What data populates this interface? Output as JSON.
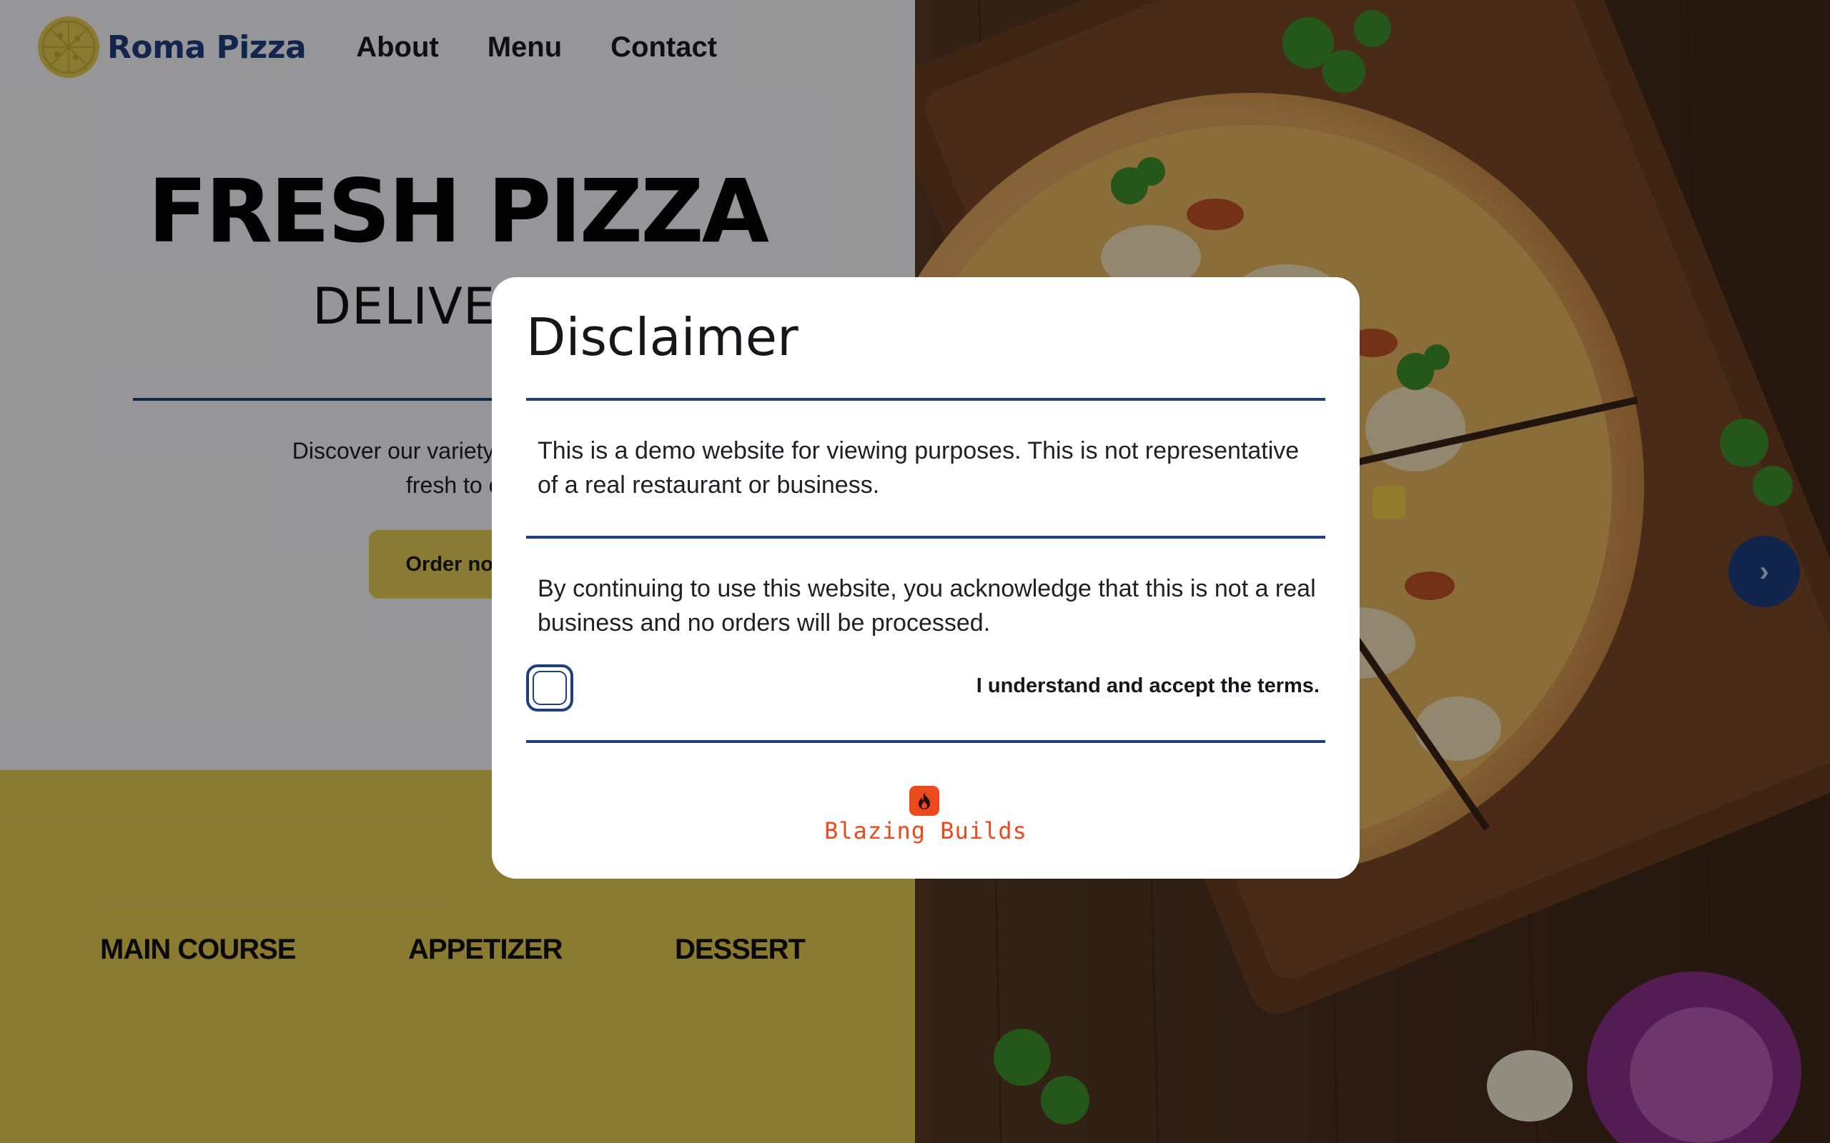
{
  "header": {
    "brand": "Roma Pizza",
    "nav": [
      "About",
      "Menu",
      "Contact"
    ]
  },
  "hero": {
    "title": "FRESH PIZZA",
    "subtitle": "DELIVERED",
    "description_line1": "Discover our variety of pizzas an",
    "description_line2": "fresh to or",
    "order_button": "Order now"
  },
  "categories": [
    "MAIN COURSE",
    "APPETIZER",
    "DESSERT"
  ],
  "carousel": {
    "next_glyph": "›"
  },
  "modal": {
    "title": "Disclaimer",
    "paragraph1": "This is a demo website for viewing purposes. This is not representative of a real restaurant or business.",
    "paragraph2": "By continuing to use this website, you acknowledge that this is not a real business and no orders will be processed.",
    "checkbox_checked": false,
    "accept_label": "I understand and accept the terms.",
    "footer_brand": "Blazing Builds"
  },
  "colors": {
    "brand_blue": "#1f3e80",
    "accent_yellow": "#e6cd53",
    "blazing_orange": "#ea4a1c"
  },
  "icons": [
    "pizza-logo-icon",
    "chevron-right-icon",
    "flame-icon"
  ]
}
